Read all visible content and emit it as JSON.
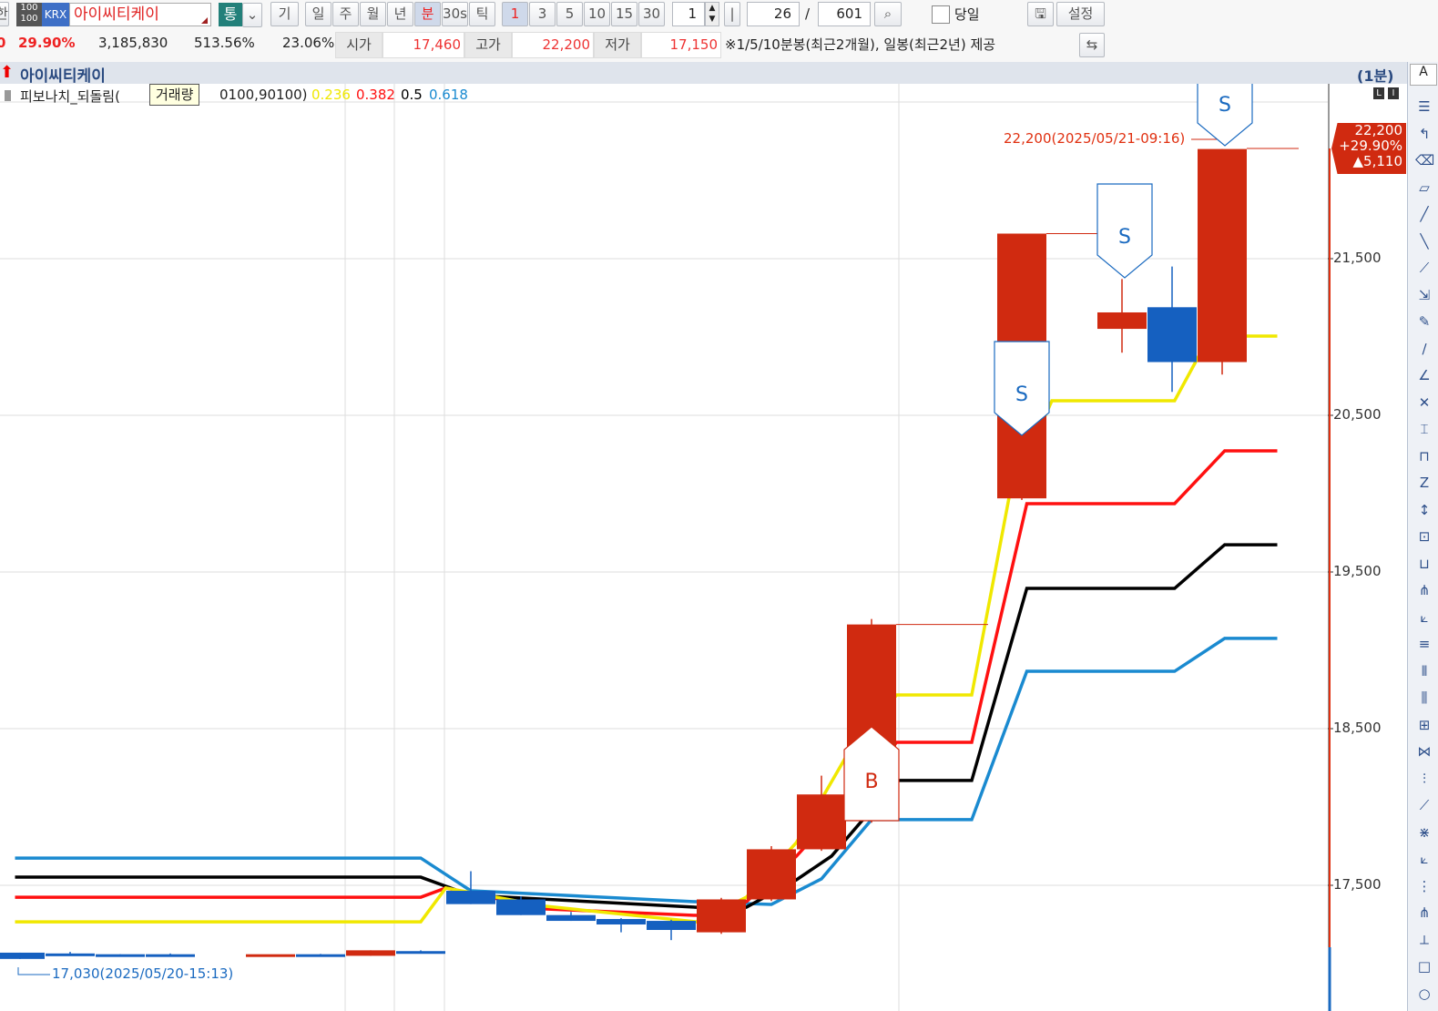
{
  "toolbar": {
    "left_partial": "한",
    "code_icon": "100\n100",
    "market": "KRX",
    "stock_name": "아이씨티케이",
    "tong": "통",
    "gi": "기",
    "periods": [
      "일",
      "주",
      "월",
      "년",
      "분",
      "30s",
      "틱"
    ],
    "active_period": "분",
    "minutes": [
      "1",
      "3",
      "5",
      "10",
      "15",
      "30"
    ],
    "active_minute": "1",
    "spinner_value": "1",
    "bar_btn": "|",
    "count": "26",
    "slash": "/",
    "total": "601",
    "today_label": "당일",
    "settings": "설정"
  },
  "quote": {
    "partial": "0",
    "change_rate": "29.90%",
    "volume": "3,185,830",
    "vol_rate": "513.56%",
    "turnover": "23.06%",
    "open_label": "시가",
    "open": "17,460",
    "high_label": "고가",
    "high": "22,200",
    "low_label": "저가",
    "low": "17,150",
    "notice": "※1/5/10분봉(최근2개월), 일봉(최근2년) 제공"
  },
  "chart_title": "아이씨티케이",
  "interval": "(1분)",
  "a_btn": "A",
  "li_btns": [
    "L",
    "I"
  ],
  "legend": {
    "name": "피보나치_되돌림(",
    "tooltip": "거래량",
    "params": "0100,90100)",
    "levels": [
      "0.236",
      "0.382",
      "0.5",
      "0.618"
    ]
  },
  "price_tag": {
    "price": "22,200",
    "rate": "+29.90%",
    "change": "▲5,110"
  },
  "annotations": {
    "high": "22,200(2025/05/21-09:16)",
    "low": "17,030(2025/05/20-15:13)"
  },
  "chart_data": {
    "type": "candlestick",
    "yticks": [
      "21,500",
      "20,500",
      "19,500",
      "18,500",
      "17,500"
    ],
    "ytick_values": [
      21500,
      20500,
      19500,
      18500,
      17500
    ],
    "candles": [
      {
        "i": -9,
        "o": 17070,
        "h": 17070,
        "c": 17030,
        "l": 17030
      },
      {
        "i": -8,
        "o": 17065,
        "h": 17075,
        "c": 17055,
        "l": 17055
      },
      {
        "i": -7,
        "o": 17060,
        "h": 17060,
        "c": 17050,
        "l": 17050
      },
      {
        "i": -6,
        "o": 17060,
        "h": 17065,
        "c": 17055,
        "l": 17055
      },
      {
        "i": -4,
        "o": 17050,
        "h": 17055,
        "c": 17060,
        "l": 17045
      },
      {
        "i": -3,
        "o": 17060,
        "h": 17062,
        "c": 17055,
        "l": 17055
      },
      {
        "i": -2,
        "o": 17050,
        "h": 17085,
        "c": 17085,
        "l": 17050
      },
      {
        "i": -1,
        "o": 17080,
        "h": 17085,
        "c": 17078,
        "l": 17078
      },
      {
        "i": 0,
        "o": 17465,
        "h": 17590,
        "c": 17380,
        "l": 17380
      },
      {
        "i": 1,
        "o": 17410,
        "h": 17430,
        "c": 17310,
        "l": 17310
      },
      {
        "i": 2,
        "o": 17310,
        "h": 17330,
        "c": 17273,
        "l": 17273
      },
      {
        "i": 3,
        "o": 17285,
        "h": 17290,
        "c": 17250,
        "l": 17200
      },
      {
        "i": 4,
        "o": 17273,
        "h": 17280,
        "c": 17215,
        "l": 17150
      },
      {
        "i": 5,
        "o": 17200,
        "h": 17420,
        "c": 17410,
        "l": 17190
      },
      {
        "i": 6,
        "o": 17410,
        "h": 17750,
        "c": 17730,
        "l": 17400
      },
      {
        "i": 7,
        "o": 17730,
        "h": 18200,
        "c": 18080,
        "l": 17720
      },
      {
        "i": 8,
        "o": 17920,
        "h": 19200,
        "c": 19165,
        "l": 17900
      },
      {
        "i": 11,
        "o": 19970,
        "h": 21660,
        "c": 21660,
        "l": 19960
      },
      {
        "i": 13,
        "o": 21052,
        "h": 21370,
        "c": 21157,
        "l": 20900
      },
      {
        "i": 14,
        "o": 21190,
        "h": 21450,
        "c": 20840,
        "l": 20650
      },
      {
        "i": 15,
        "o": 20840,
        "h": 22200,
        "c": 22200,
        "l": 20760
      }
    ],
    "series": [
      {
        "name": "0.618",
        "color": "#1a8ad0",
        "points": [
          [
            -9.1,
            17674
          ],
          [
            -1,
            17674
          ],
          [
            0,
            17465
          ],
          [
            4.5,
            17395
          ],
          [
            6,
            17378
          ],
          [
            7,
            17541
          ],
          [
            8,
            17919
          ],
          [
            10,
            17919
          ],
          [
            11.1,
            18866
          ],
          [
            14.05,
            18866
          ],
          [
            15.05,
            19076
          ],
          [
            16.1,
            19076
          ]
        ]
      },
      {
        "name": "0.5",
        "color": "#000000",
        "points": [
          [
            -9.1,
            17552
          ],
          [
            -1,
            17552
          ],
          [
            0,
            17436
          ],
          [
            4.5,
            17360
          ],
          [
            5.5,
            17360
          ],
          [
            6.5,
            17535
          ],
          [
            7.2,
            17686
          ],
          [
            8.5,
            18169
          ],
          [
            10,
            18169
          ],
          [
            11.1,
            19395
          ],
          [
            14.05,
            19395
          ],
          [
            15.05,
            19674
          ],
          [
            16.1,
            19674
          ]
        ]
      },
      {
        "name": "0.382",
        "color": "#ff1010",
        "points": [
          [
            -9.1,
            17424
          ],
          [
            -1,
            17424
          ],
          [
            -0.5,
            17483
          ],
          [
            1.5,
            17349
          ],
          [
            4.5,
            17308
          ],
          [
            5.5,
            17395
          ],
          [
            6.5,
            17686
          ],
          [
            7.5,
            18035
          ],
          [
            8.5,
            18413
          ],
          [
            10,
            18413
          ],
          [
            11.1,
            19936
          ],
          [
            14.05,
            19936
          ],
          [
            15.05,
            20273
          ],
          [
            16.1,
            20273
          ]
        ]
      },
      {
        "name": "0.236",
        "color": "#f0e800",
        "points": [
          [
            -9.1,
            17267
          ],
          [
            -1,
            17267
          ],
          [
            -0.5,
            17483
          ],
          [
            1.5,
            17366
          ],
          [
            4.5,
            17267
          ],
          [
            5.5,
            17424
          ],
          [
            6.5,
            17773
          ],
          [
            7.5,
            18326
          ],
          [
            8.5,
            18715
          ],
          [
            10,
            18715
          ],
          [
            10.75,
            19983
          ],
          [
            11.6,
            20593
          ],
          [
            14.05,
            20593
          ],
          [
            14.75,
            21006
          ],
          [
            16.1,
            21006
          ]
        ]
      }
    ],
    "signals": [
      {
        "type": "S",
        "i": 11,
        "price": 20950
      },
      {
        "type": "S",
        "i": 13,
        "price": 21400
      },
      {
        "type": "S",
        "i": 15,
        "price": 22250
      },
      {
        "type": "B",
        "i": 8,
        "price": 18500
      }
    ]
  }
}
